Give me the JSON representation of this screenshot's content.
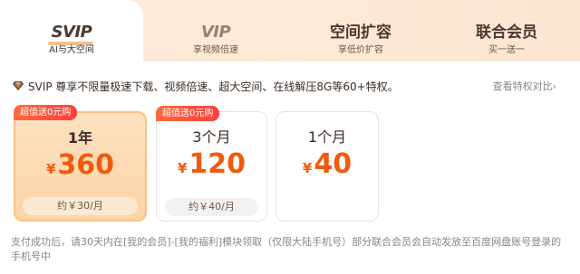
{
  "tabs": [
    {
      "title": "SVIP",
      "subtitle": "AI与大空间",
      "active": true
    },
    {
      "title": "VIP",
      "subtitle": "享视频倍速",
      "active": false
    },
    {
      "title": "空间扩容",
      "subtitle": "享低价扩容",
      "active": false
    },
    {
      "title": "联合会员",
      "subtitle": "买一送一",
      "active": false
    }
  ],
  "description": "SVIP 尊享不限量极速下载、视频倍速、超大空间、在线解压8G等60+特权。",
  "compare_link": "查看特权对比",
  "compare_chevron": "›",
  "plans": [
    {
      "badge": "超值送0元购",
      "period": "1年",
      "currency": "¥",
      "price": "360",
      "monthly": "约￥30/月",
      "selected": true
    },
    {
      "badge": "超值送0元购",
      "period": "3个月",
      "currency": "¥",
      "price": "120",
      "monthly": "约￥40/月",
      "selected": false
    },
    {
      "period": "1个月",
      "currency": "¥",
      "price": "40",
      "selected": false
    }
  ],
  "footnote": "支付成功后，请30天内在[我的会员]-[我的福利]模块领取（仅限大陆手机号）部分联合会员会自动发放至百度网盘账号登录的手机号中",
  "colors": {
    "accent": "#f15a0c",
    "badge": "#ff4a3d",
    "selected_border": "#f6c488"
  }
}
